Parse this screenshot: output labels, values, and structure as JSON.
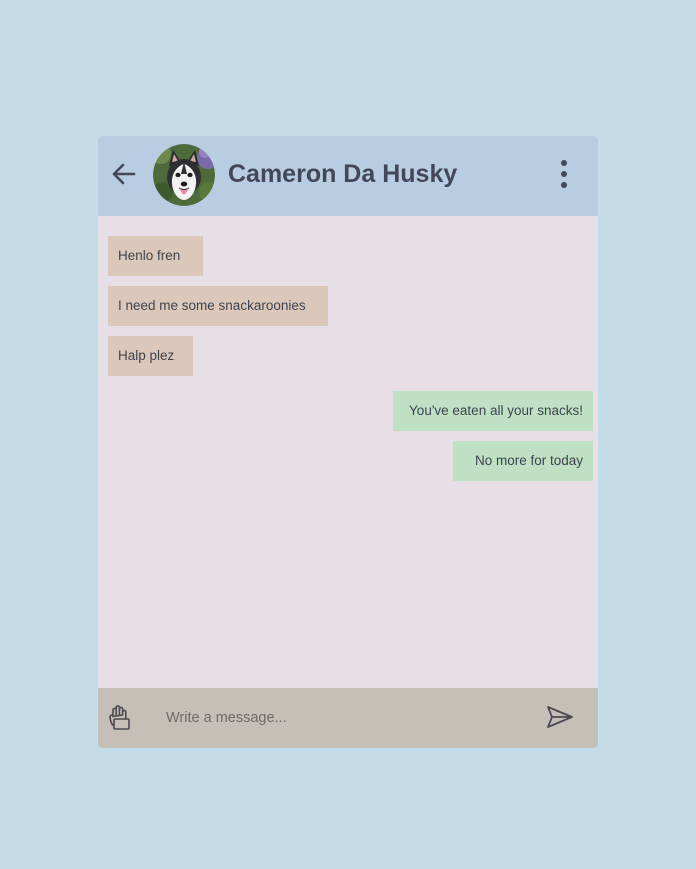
{
  "header": {
    "contact_name": "Cameron Da Husky",
    "back_icon": "arrow-left-icon",
    "menu_icon": "more-vertical-icon"
  },
  "messages": [
    {
      "direction": "incoming",
      "text": "Henlo fren"
    },
    {
      "direction": "incoming",
      "text": "I need me some snackaroonies"
    },
    {
      "direction": "incoming",
      "text": "Halp plez"
    },
    {
      "direction": "outgoing",
      "text": "You've eaten all your snacks!"
    },
    {
      "direction": "outgoing",
      "text": "No more for today"
    }
  ],
  "composer": {
    "placeholder": "Write a message...",
    "value": "",
    "attach_icon": "paperclip-hand-icon",
    "send_icon": "send-icon"
  },
  "colors": {
    "page_background": "#c4dbe8",
    "header_background": "#b9cde2",
    "chat_background": "#e6dfe6",
    "incoming_bubble": "#dcc8ba",
    "outgoing_bubble": "#bfe0c2",
    "composer_background": "#c4c0b8",
    "text": "#424857"
  }
}
